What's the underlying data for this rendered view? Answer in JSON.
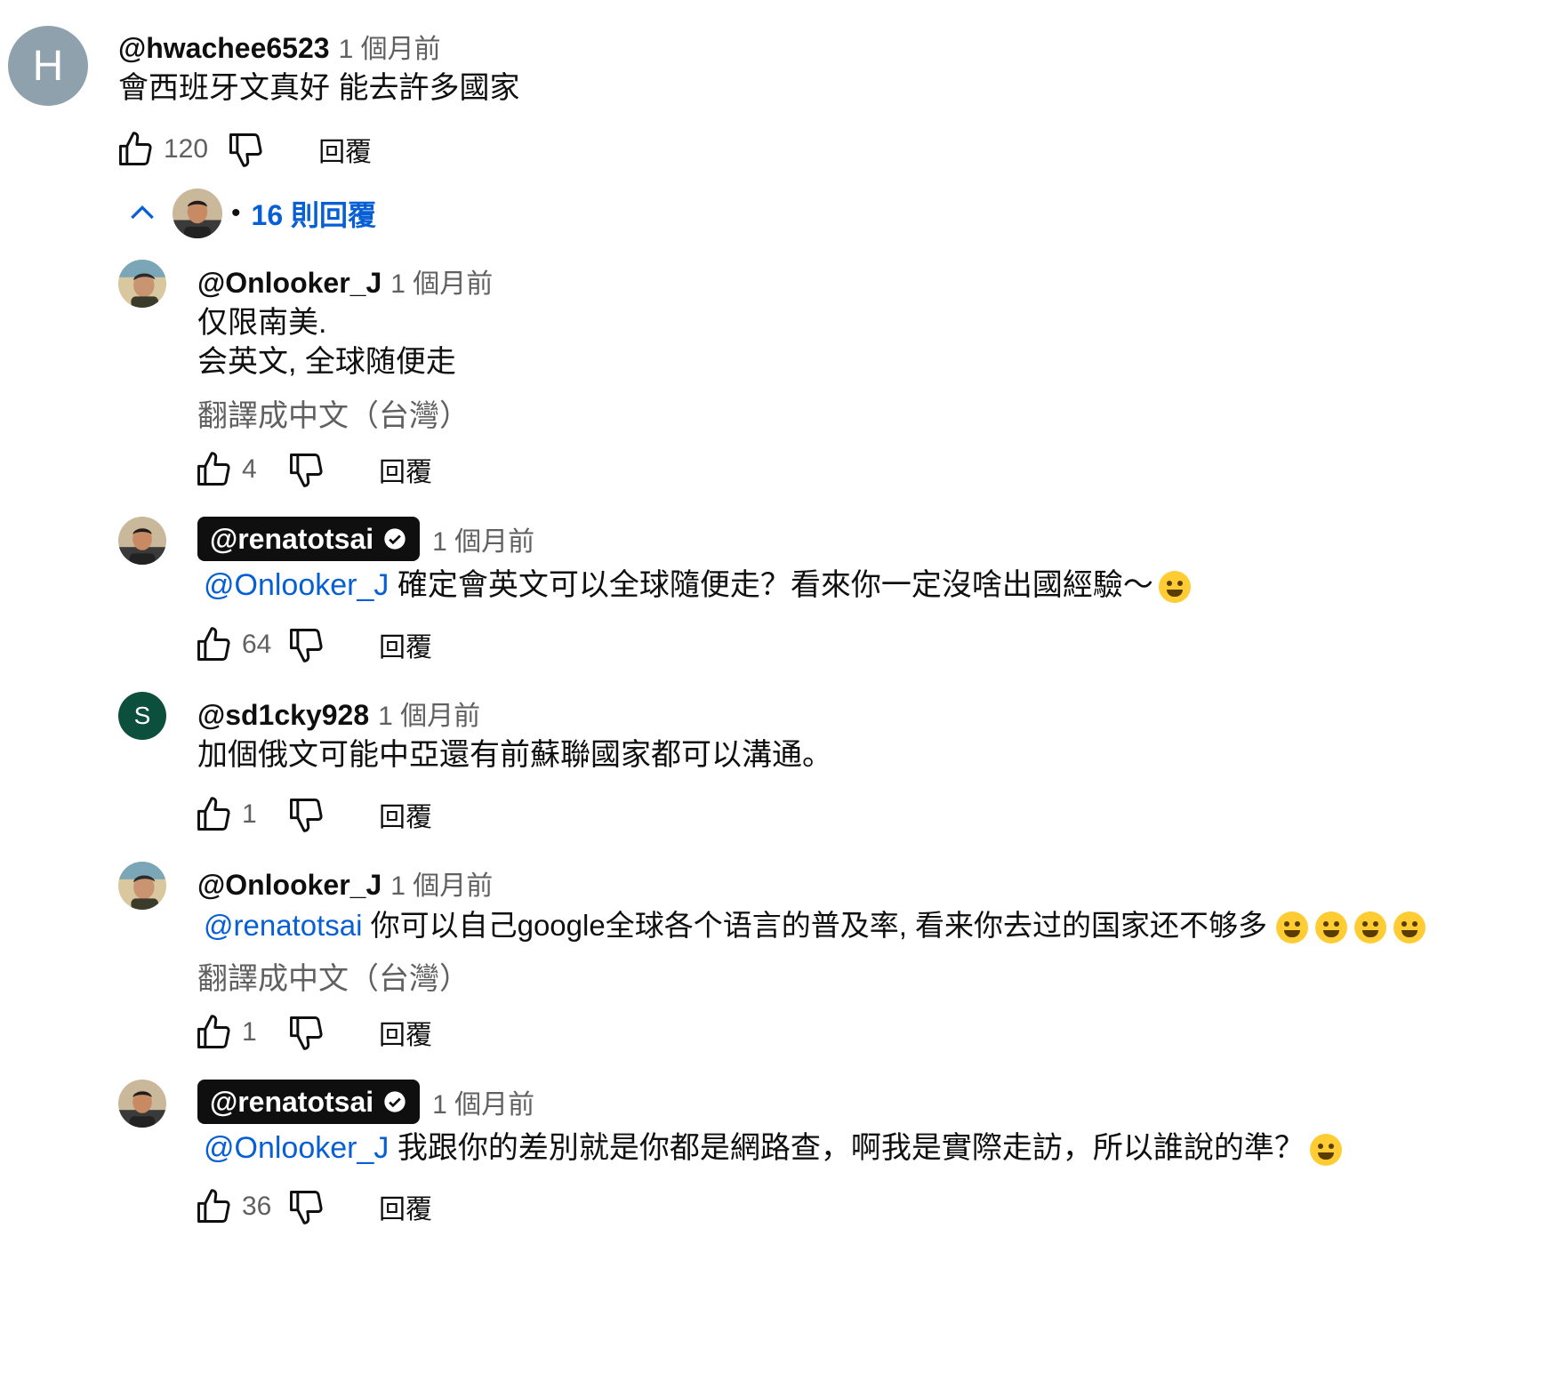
{
  "top_comment": {
    "avatar_letter": "H",
    "avatar_color": "#8fa1ad",
    "handle": "@hwachee6523",
    "time": "1 個月前",
    "text": "會西班牙文真好 能去許多國家",
    "likes": "120",
    "reply_label": "回覆",
    "replies_toggle": "16 則回覆",
    "replies_dot": "•"
  },
  "replies": [
    {
      "handle": "@Onlooker_J",
      "time": "1 個月前",
      "lines": [
        "仅限南美.",
        "会英文, 全球随便走"
      ],
      "translate": "翻譯成中文（台灣）",
      "likes": "4",
      "reply_label": "回覆"
    },
    {
      "handle": "@renatotsai",
      "time": "1 個月前",
      "mention": "@Onlooker_J",
      "text": " 確定會英文可以全球隨便走？看來你一定沒啥出國經驗～",
      "emoji": "rofl",
      "likes": "64",
      "reply_label": "回覆"
    },
    {
      "avatar_letter": "S",
      "avatar_color": "#0b4f3c",
      "handle": "@sd1cky928",
      "time": "1 個月前",
      "text": "加個俄文可能中亞還有前蘇聯國家都可以溝通。",
      "likes": "1",
      "reply_label": "回覆"
    },
    {
      "handle": "@Onlooker_J",
      "time": "1 個月前",
      "mention": "@renatotsai",
      "text": "  你可以自己google全球各个语言的普及率, 看来你去过的国家还不够多",
      "emoji": "joy x4",
      "translate": "翻譯成中文（台灣）",
      "likes": "1",
      "reply_label": "回覆"
    },
    {
      "handle": "@renatotsai",
      "time": "1 個月前",
      "mention": "@Onlooker_J",
      "text": " 我跟你的差別就是你都是網路查，啊我是實際走訪，所以誰說的準？",
      "emoji": "wink",
      "likes": "36",
      "reply_label": "回覆"
    }
  ],
  "colors": {
    "link_blue": "#065fd4",
    "secondary_text": "#606060",
    "owner_badge_bg": "#0f0f0f"
  }
}
